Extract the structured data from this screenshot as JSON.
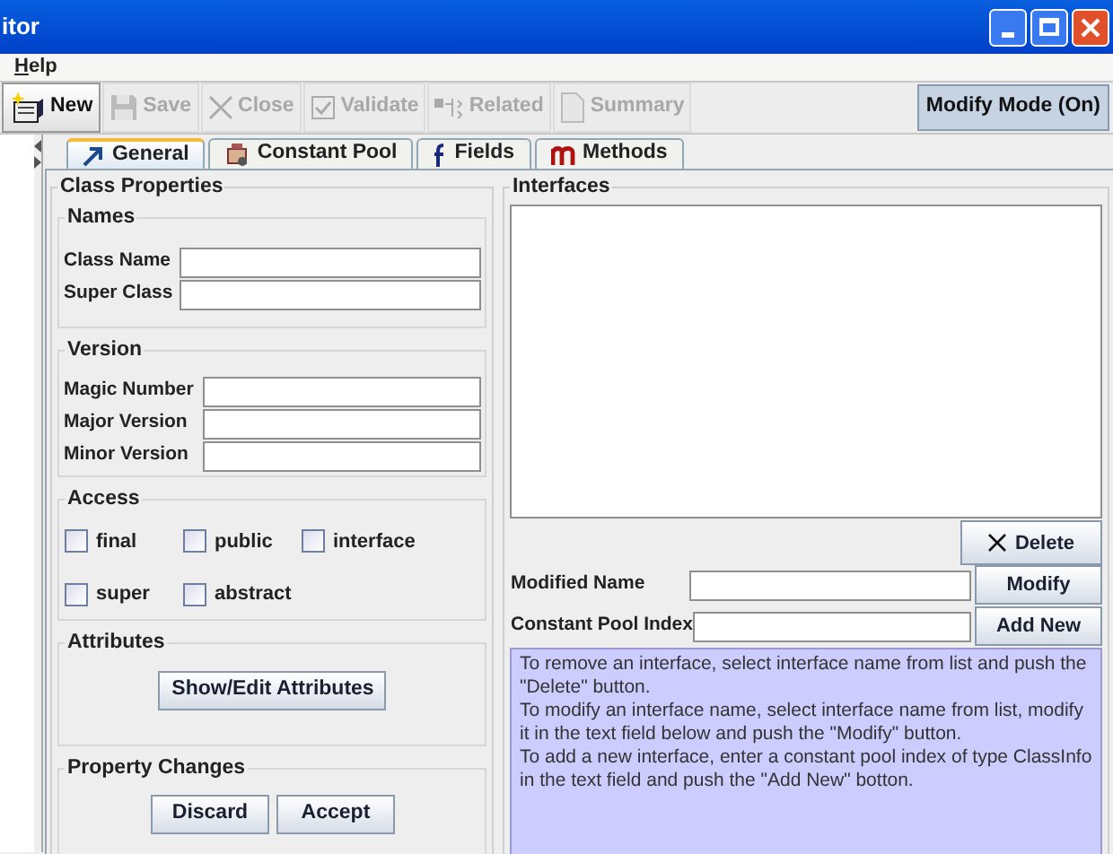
{
  "window": {
    "title": "itor"
  },
  "menu": [
    {
      "label": "Help"
    }
  ],
  "toolbar": [
    {
      "label": "New",
      "disabled": false
    },
    {
      "label": "Save",
      "disabled": true
    },
    {
      "label": "Close",
      "disabled": true
    },
    {
      "label": "Validate",
      "disabled": true
    },
    {
      "label": "Related",
      "disabled": true
    },
    {
      "label": "Summary",
      "disabled": true
    }
  ],
  "mode_button": {
    "label": "Modify Mode (On)",
    "on": true
  },
  "tabs": [
    {
      "label": "General",
      "selected": true
    },
    {
      "label": "Constant Pool",
      "selected": false
    },
    {
      "label": "Fields",
      "selected": false
    },
    {
      "label": "Methods",
      "selected": false
    }
  ],
  "class_properties": {
    "title": "Class Properties",
    "names": {
      "title": "Names",
      "fields": [
        {
          "label": "Class Name"
        },
        {
          "label": "Super Class"
        }
      ]
    },
    "version": {
      "title": "Version",
      "fields": [
        {
          "label": "Magic Number"
        },
        {
          "label": "Major Version"
        },
        {
          "label": "Minor Version"
        }
      ]
    },
    "access": {
      "title": "Access",
      "flags": [
        {
          "label": "final",
          "checked": false
        },
        {
          "label": "public",
          "checked": false
        },
        {
          "label": "interface",
          "checked": false
        },
        {
          "label": "super",
          "checked": false
        },
        {
          "label": "abstract",
          "checked": false
        }
      ]
    },
    "attributes": {
      "title": "Attributes",
      "button": "Show/Edit Attributes"
    },
    "property_changes": {
      "title": "Property Changes",
      "buttons": [
        "Discard",
        "Accept"
      ]
    }
  },
  "interfaces": {
    "title": "Interfaces",
    "delete_button": "Delete",
    "rows": [
      {
        "label": "Modified Name",
        "button": "Modify"
      },
      {
        "label": "Constant Pool Index",
        "button": "Add New"
      }
    ],
    "help": [
      "To remove an interface, select interface name from list and push the \"Delete\" button.",
      "To modify an interface name, select interface name from list, modify it in the text field below and push the \"Modify\" button.",
      "To add a new interface, enter a constant pool index of type ClassInfo in the text field and push the \"Add New\" botton."
    ]
  }
}
